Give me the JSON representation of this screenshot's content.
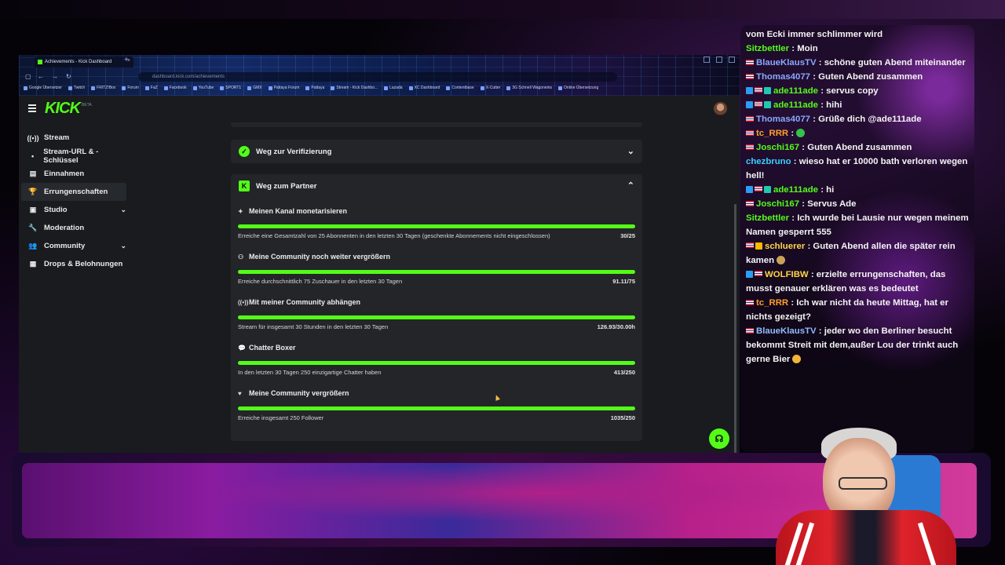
{
  "browser": {
    "tab_title": "Achievements - Kick Dashboard",
    "tab_close": "×",
    "new_tab": "+",
    "address": "dashboard.kick.com/achievements",
    "bookmarks": [
      "Google Übersetzer",
      "Twitch",
      "FRITZ!Box",
      "Forum",
      "FaZ",
      "Facebook",
      "YouTube",
      "SPORT1",
      "GMX",
      "Pattaya Forum",
      "Pattaya",
      "Stream - Kick Dashbo...",
      "Lazada",
      "XC Dashboard",
      "Contentbase",
      "X-Cutter",
      "3G Schnell Wagoneins",
      "Online Übersetzung"
    ]
  },
  "kick": {
    "logo": "KICK",
    "logo_suffix": "BETA"
  },
  "sidebar": {
    "items": [
      {
        "label": "Stream",
        "icon": "((•))"
      },
      {
        "label": "Stream-URL & -Schlüssel",
        "icon": "•"
      },
      {
        "label": "Einnahmen",
        "icon": "▤"
      },
      {
        "label": "Errungenschaften",
        "icon": "🏆"
      },
      {
        "label": "Studio",
        "icon": "▣",
        "chevron": "⌄"
      },
      {
        "label": "Moderation",
        "icon": "🔧"
      },
      {
        "label": "Community",
        "icon": "👥",
        "chevron": "⌄"
      },
      {
        "label": "Drops & Belohnungen",
        "icon": "▦"
      }
    ]
  },
  "main": {
    "verification": {
      "title": "Weg zur Verifizierung",
      "badge": "✓",
      "chevron": "⌄"
    },
    "partner": {
      "title": "Weg zum Partner",
      "badge": "K",
      "chevron": "⌃",
      "achievements": [
        {
          "icon": "✦",
          "title": "Meinen Kanal monetarisieren",
          "desc": "Erreiche eine Gesamtzahl von 25 Abonnenten in den letzten 30 Tagen (geschenkte Abonnements nicht eingeschlossen)",
          "value": "30/25",
          "progress": 1.0
        },
        {
          "icon": "⚇",
          "title": "Meine Community noch weiter vergrößern",
          "desc": "Erreiche durchschnittlich 75 Zuschauer in den letzten 30 Tagen",
          "value": "91.11/75",
          "progress": 1.0
        },
        {
          "icon": "((•))",
          "title": "Mit meiner Community abhängen",
          "desc": "Stream für insgesamt 30 Stunden in den letzten 30 Tagen",
          "value": "126.93/30.00h",
          "progress": 1.0
        },
        {
          "icon": "💬",
          "title": "Chatter Boxer",
          "desc": "In den letzten 30 Tagen 250 einzigartige Chatter haben",
          "value": "413/250",
          "progress": 1.0
        },
        {
          "icon": "♥",
          "title": "Meine Community vergrößern",
          "desc": "Erreiche insgesamt 250 Follower",
          "value": "1035/250",
          "progress": 1.0
        }
      ]
    },
    "support_icon": "☊"
  },
  "chat": {
    "messages": [
      {
        "badges": [],
        "user": "",
        "text": "vom Ecki immer schlimmer wird",
        "color": ""
      },
      {
        "badges": [],
        "user": "Sitzbettler",
        "text": ": Moin",
        "color": "u1"
      },
      {
        "badges": [
          "flag"
        ],
        "user": "BlaueKlausTV",
        "text": ": schöne guten Abend miteinander",
        "color": "u2"
      },
      {
        "badges": [
          "flag"
        ],
        "user": "Thomas4077",
        "text": ": Guten Abend zusammen",
        "color": "u2"
      },
      {
        "badges": [
          "sub",
          "flag",
          "gift"
        ],
        "user": "ade111ade",
        "text": ": servus copy",
        "color": "u1"
      },
      {
        "badges": [
          "sub",
          "flag",
          "gift"
        ],
        "user": "ade111ade",
        "text": ": hihi",
        "color": "u1"
      },
      {
        "badges": [
          "flag"
        ],
        "user": "Thomas4077",
        "text": ": Grüße dich @ade111ade",
        "color": "u2"
      },
      {
        "badges": [
          "flag"
        ],
        "user": "tc_RRR",
        "text": ":",
        "color": "u3",
        "emote": "#33c24a"
      },
      {
        "badges": [
          "flag"
        ],
        "user": "Joschi167",
        "text": ": Guten Abend zusammen",
        "color": "u1"
      },
      {
        "badges": [],
        "user": "chezbruno",
        "text": ": wieso hat er 10000 bath verloren wegen hell!",
        "color": "u4"
      },
      {
        "badges": [
          "sub",
          "flag",
          "gift"
        ],
        "user": "ade111ade",
        "text": ": hi",
        "color": "u1"
      },
      {
        "badges": [
          "flag"
        ],
        "user": "Joschi167",
        "text": ": Servus Ade",
        "color": "u1"
      },
      {
        "badges": [],
        "user": "Sitzbettler",
        "text": ": Ich wurde bei Lausie nur wegen meinem Namen gesperrt 555",
        "color": "u1"
      },
      {
        "badges": [
          "flag",
          "crown"
        ],
        "user": "schluerer",
        "text": ": Guten Abend allen die später rein kamen",
        "color": "u5",
        "emote": "#c9a25a"
      },
      {
        "badges": [
          "sub",
          "flag"
        ],
        "user": "WOLFIBW",
        "text": ": erzielte errungenschaften, das musst genauer erklären was es bedeutet",
        "color": "u5"
      },
      {
        "badges": [
          "flag"
        ],
        "user": "tc_RRR",
        "text": ": Ich war nicht da heute Mittag, hat er nichts gezeigt?",
        "color": "u3"
      },
      {
        "badges": [
          "flag"
        ],
        "user": "BlaueKlausTV",
        "text": ": jeder wo den Berliner besucht bekommt Streit mit dem,außer Lou der trinkt auch gerne Bier",
        "color": "u6",
        "emote": "#f2b33a"
      }
    ]
  },
  "colors": {
    "accent": "#53fc18",
    "panel": "#232529",
    "page": "#191b1f"
  }
}
